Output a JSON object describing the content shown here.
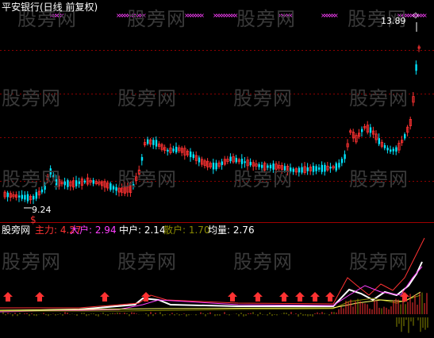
{
  "header": {
    "title": "平安银行(日线 前复权)"
  },
  "price_chart": {
    "high_label": "13.89",
    "low_label": "9.24",
    "up_color": "#ff3232",
    "down_color": "#00e5ff"
  },
  "indicator": {
    "name": "股旁网",
    "values": [
      {
        "label": "主力:",
        "value": "4.27",
        "color": "#ff3232"
      },
      {
        "label": "大户:",
        "value": "2.94",
        "color": "#ff40ff"
      },
      {
        "label": "中户:",
        "value": "2.14",
        "color": "#ffffff"
      },
      {
        "label": "散户:",
        "value": "1.70",
        "color": "#8a8a00"
      },
      {
        "label": "均量:",
        "value": "2.76",
        "color": "#ffffff"
      }
    ]
  },
  "watermark": {
    "text": "股旁网"
  },
  "colors": {
    "background": "#000000",
    "grid": "#8b0000",
    "marker_pink": "#ff40ff",
    "arrow_red": "#ff3232"
  }
}
